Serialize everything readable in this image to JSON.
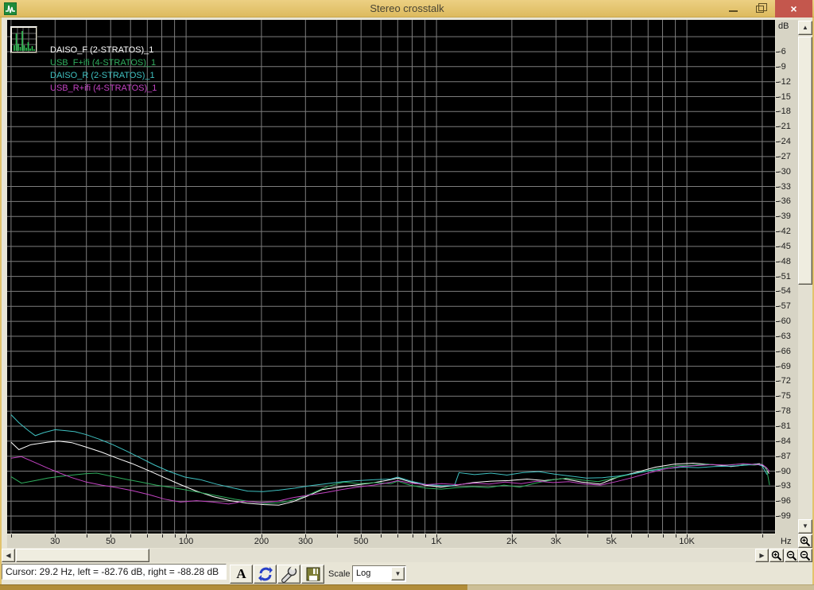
{
  "window": {
    "title": "Stereo crosstalk",
    "close_glyph": "×"
  },
  "icons": {
    "scroll_up": "▲",
    "scroll_down": "▼",
    "scroll_left": "◀",
    "scroll_right": "▶",
    "dropdown_arrow": "▼",
    "toolbar": [
      "font-button",
      "refresh-button",
      "wrench-setup-button",
      "save-button"
    ],
    "zoom_buttons": [
      "zoom-in-horizontal",
      "zoom-out-horizontal",
      "zoom-in-vertical",
      "zoom-out-vertical"
    ]
  },
  "status": {
    "cursor_text": "Cursor:  29.2 Hz,  left = -82.76 dB,  right = -88.28 dB"
  },
  "toolbar": {
    "font_button_label": "A",
    "scale_label": "Scale",
    "scale_value": "Log"
  },
  "chart_data": {
    "type": "line",
    "title": "Stereo crosstalk",
    "x_scale": "log",
    "x_unit": "Hz",
    "y_unit": "dB",
    "x_range_hz": [
      19.3,
      22500
    ],
    "y_range_db": [
      0,
      -102.5
    ],
    "y_gridline_step_db": 3,
    "grid_color": "#7e7e7e",
    "background": "#000000",
    "legend_position": "top-left",
    "x_gridlines_hz": [
      20,
      30,
      40,
      50,
      60,
      70,
      80,
      90,
      100,
      200,
      300,
      400,
      500,
      600,
      700,
      800,
      900,
      1000,
      2000,
      3000,
      4000,
      5000,
      6000,
      7000,
      8000,
      9000,
      10000,
      20000
    ],
    "x_tick_labels": [
      {
        "label": "30",
        "hz": 30
      },
      {
        "label": "50",
        "hz": 50
      },
      {
        "label": "100",
        "hz": 100
      },
      {
        "label": "200",
        "hz": 200
      },
      {
        "label": "300",
        "hz": 300
      },
      {
        "label": "500",
        "hz": 500
      },
      {
        "label": "1K",
        "hz": 1000
      },
      {
        "label": "2K",
        "hz": 2000
      },
      {
        "label": "3K",
        "hz": 3000
      },
      {
        "label": "5K",
        "hz": 5000
      },
      {
        "label": "10K",
        "hz": 10000
      }
    ],
    "y_tick_labels": [
      "-6",
      "-9",
      "-12",
      "-15",
      "-18",
      "-21",
      "-24",
      "-27",
      "-30",
      "-33",
      "-36",
      "-39",
      "-42",
      "-45",
      "-48",
      "-51",
      "-54",
      "-57",
      "-60",
      "-63",
      "-66",
      "-69",
      "-72",
      "-75",
      "-78",
      "-81",
      "-84",
      "-87",
      "-90",
      "-93",
      "-96",
      "-99"
    ],
    "series": [
      {
        "name": "DAISO_F (2-STRATOS)_1",
        "color": "#ffffff",
        "points": [
          [
            20,
            -84.2
          ],
          [
            21.5,
            -85.7
          ],
          [
            24,
            -84.7
          ],
          [
            28,
            -84.2
          ],
          [
            31,
            -84.0
          ],
          [
            35,
            -84.3
          ],
          [
            40,
            -85.2
          ],
          [
            46,
            -86.2
          ],
          [
            53,
            -87.4
          ],
          [
            61,
            -88.5
          ],
          [
            71,
            -89.9
          ],
          [
            82,
            -91.3
          ],
          [
            95,
            -92.7
          ],
          [
            110,
            -94.0
          ],
          [
            128,
            -95.1
          ],
          [
            150,
            -95.9
          ],
          [
            175,
            -96.4
          ],
          [
            205,
            -96.7
          ],
          [
            235,
            -96.8
          ],
          [
            268,
            -96.1
          ],
          [
            305,
            -95.0
          ],
          [
            350,
            -93.7
          ],
          [
            405,
            -93.2
          ],
          [
            470,
            -92.8
          ],
          [
            545,
            -92.4
          ],
          [
            630,
            -91.9
          ],
          [
            700,
            -91.4
          ],
          [
            780,
            -92.1
          ],
          [
            900,
            -92.8
          ],
          [
            1040,
            -93.2
          ],
          [
            1200,
            -92.8
          ],
          [
            1400,
            -92.3
          ],
          [
            1650,
            -92.0
          ],
          [
            1950,
            -91.9
          ],
          [
            2300,
            -91.6
          ],
          [
            2700,
            -91.9
          ],
          [
            3200,
            -91.5
          ],
          [
            3800,
            -92.2
          ],
          [
            4500,
            -92.6
          ],
          [
            5300,
            -91.2
          ],
          [
            6300,
            -90.2
          ],
          [
            7500,
            -89.2
          ],
          [
            8900,
            -88.6
          ],
          [
            10600,
            -88.4
          ],
          [
            12600,
            -88.7
          ],
          [
            15000,
            -89.1
          ],
          [
            17800,
            -88.7
          ],
          [
            19500,
            -88.5
          ],
          [
            20500,
            -89.2
          ],
          [
            21300,
            -90.5
          ]
        ]
      },
      {
        "name": "USB_F+ifi (4-STRATOS)_1",
        "color": "#2fae5e",
        "points": [
          [
            20,
            -91.1
          ],
          [
            22,
            -92.4
          ],
          [
            25,
            -91.9
          ],
          [
            28,
            -91.4
          ],
          [
            31,
            -91.1
          ],
          [
            35,
            -90.8
          ],
          [
            40,
            -90.5
          ],
          [
            44,
            -90.4
          ],
          [
            50,
            -91.0
          ],
          [
            57,
            -91.6
          ],
          [
            66,
            -92.2
          ],
          [
            76,
            -92.8
          ],
          [
            88,
            -93.3
          ],
          [
            101,
            -93.8
          ],
          [
            117,
            -94.4
          ],
          [
            135,
            -95.0
          ],
          [
            156,
            -95.6
          ],
          [
            180,
            -96.1
          ],
          [
            208,
            -96.5
          ],
          [
            240,
            -96.3
          ],
          [
            277,
            -95.6
          ],
          [
            320,
            -94.4
          ],
          [
            370,
            -93.0
          ],
          [
            427,
            -92.2
          ],
          [
            493,
            -92.5
          ],
          [
            570,
            -92.3
          ],
          [
            658,
            -92.5
          ],
          [
            700,
            -92.0
          ],
          [
            785,
            -92.8
          ],
          [
            905,
            -93.4
          ],
          [
            1045,
            -93.6
          ],
          [
            1210,
            -93.3
          ],
          [
            1395,
            -93.1
          ],
          [
            1610,
            -93.3
          ],
          [
            1860,
            -92.8
          ],
          [
            2150,
            -93.2
          ],
          [
            2480,
            -92.4
          ],
          [
            2870,
            -91.8
          ],
          [
            3310,
            -91.4
          ],
          [
            3820,
            -91.8
          ],
          [
            4420,
            -92.1
          ],
          [
            5100,
            -91.4
          ],
          [
            5890,
            -90.7
          ],
          [
            6800,
            -90.0
          ],
          [
            7860,
            -89.4
          ],
          [
            9080,
            -88.9
          ],
          [
            10500,
            -88.8
          ],
          [
            12100,
            -88.6
          ],
          [
            14000,
            -88.8
          ],
          [
            16100,
            -88.6
          ],
          [
            18600,
            -88.8
          ],
          [
            20000,
            -88.6
          ],
          [
            20800,
            -89.5
          ],
          [
            21400,
            -92.8
          ]
        ]
      },
      {
        "name": "DAISO_R (2-STRATOS)_1",
        "color": "#3fc1c1",
        "points": [
          [
            20,
            -78.7
          ],
          [
            21.5,
            -80.3
          ],
          [
            23.5,
            -81.9
          ],
          [
            25,
            -82.9
          ],
          [
            27,
            -82.3
          ],
          [
            30,
            -81.7
          ],
          [
            33,
            -81.9
          ],
          [
            36,
            -82.1
          ],
          [
            40,
            -82.7
          ],
          [
            45,
            -83.6
          ],
          [
            51,
            -84.7
          ],
          [
            58,
            -86.0
          ],
          [
            66,
            -87.4
          ],
          [
            75,
            -88.8
          ],
          [
            86,
            -90.1
          ],
          [
            99,
            -91.2
          ],
          [
            114,
            -91.7
          ],
          [
            132,
            -92.6
          ],
          [
            152,
            -93.3
          ],
          [
            176,
            -94.0
          ],
          [
            203,
            -94.1
          ],
          [
            235,
            -93.8
          ],
          [
            272,
            -93.4
          ],
          [
            315,
            -92.9
          ],
          [
            365,
            -92.5
          ],
          [
            423,
            -92.1
          ],
          [
            490,
            -91.9
          ],
          [
            567,
            -91.7
          ],
          [
            656,
            -91.6
          ],
          [
            700,
            -91.2
          ],
          [
            790,
            -92.0
          ],
          [
            915,
            -92.7
          ],
          [
            1060,
            -92.9
          ],
          [
            1180,
            -92.9
          ],
          [
            1230,
            -90.3
          ],
          [
            1420,
            -90.7
          ],
          [
            1650,
            -90.4
          ],
          [
            1910,
            -90.8
          ],
          [
            2210,
            -90.3
          ],
          [
            2560,
            -90.1
          ],
          [
            2960,
            -90.6
          ],
          [
            3430,
            -91.0
          ],
          [
            3970,
            -91.4
          ],
          [
            4600,
            -91.3
          ],
          [
            5320,
            -91.0
          ],
          [
            6160,
            -90.5
          ],
          [
            7130,
            -89.9
          ],
          [
            8250,
            -89.5
          ],
          [
            9560,
            -89.2
          ],
          [
            11100,
            -89.3
          ],
          [
            12800,
            -89.1
          ],
          [
            14800,
            -89.0
          ],
          [
            17200,
            -88.8
          ],
          [
            19000,
            -88.6
          ],
          [
            20000,
            -89.0
          ],
          [
            20900,
            -90.7
          ]
        ]
      },
      {
        "name": "USB_R+ifi (4-STRATOS)_1",
        "color": "#c343c3",
        "points": [
          [
            20,
            -87.4
          ],
          [
            22,
            -87.1
          ],
          [
            25,
            -88.3
          ],
          [
            28,
            -89.4
          ],
          [
            31,
            -90.3
          ],
          [
            35,
            -91.3
          ],
          [
            40,
            -92.2
          ],
          [
            46,
            -92.8
          ],
          [
            53,
            -93.3
          ],
          [
            61,
            -93.9
          ],
          [
            71,
            -94.7
          ],
          [
            82,
            -95.6
          ],
          [
            95,
            -96.2
          ],
          [
            110,
            -95.9
          ],
          [
            128,
            -96.2
          ],
          [
            148,
            -96.6
          ],
          [
            172,
            -96.0
          ],
          [
            200,
            -96.3
          ],
          [
            232,
            -96.0
          ],
          [
            268,
            -95.3
          ],
          [
            310,
            -94.8
          ],
          [
            360,
            -94.3
          ],
          [
            417,
            -93.7
          ],
          [
            483,
            -93.2
          ],
          [
            560,
            -92.8
          ],
          [
            648,
            -92.3
          ],
          [
            700,
            -91.9
          ],
          [
            790,
            -92.4
          ],
          [
            910,
            -92.7
          ],
          [
            1050,
            -92.5
          ],
          [
            1215,
            -92.7
          ],
          [
            1405,
            -92.4
          ],
          [
            1625,
            -92.6
          ],
          [
            1880,
            -92.2
          ],
          [
            2180,
            -92.5
          ],
          [
            2520,
            -92.0
          ],
          [
            2920,
            -92.3
          ],
          [
            3380,
            -92.1
          ],
          [
            3910,
            -92.6
          ],
          [
            4520,
            -92.8
          ],
          [
            5230,
            -92.1
          ],
          [
            6050,
            -91.3
          ],
          [
            7000,
            -90.4
          ],
          [
            8100,
            -89.6
          ],
          [
            9370,
            -89.1
          ],
          [
            10800,
            -88.9
          ],
          [
            12500,
            -88.7
          ],
          [
            14500,
            -88.8
          ],
          [
            16800,
            -88.5
          ],
          [
            18800,
            -88.7
          ],
          [
            20000,
            -88.7
          ],
          [
            20800,
            -89.3
          ],
          [
            21400,
            -90.1
          ]
        ]
      }
    ]
  }
}
